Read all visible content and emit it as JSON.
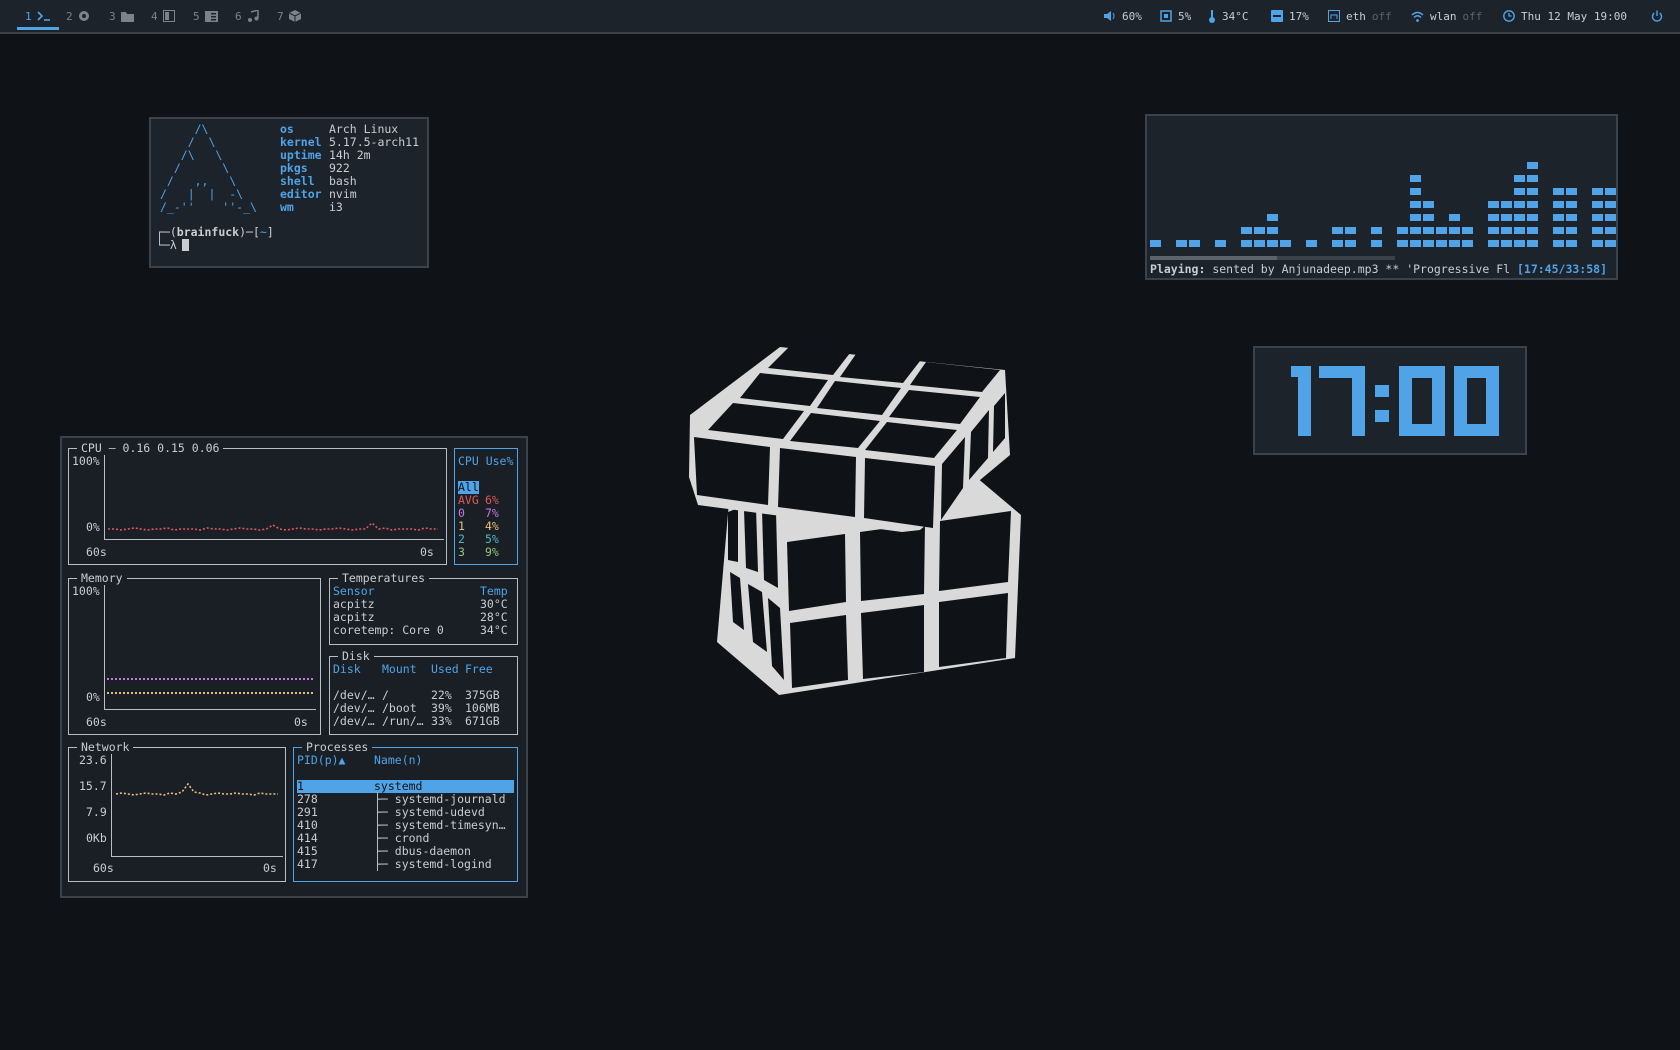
{
  "topbar": {
    "workspaces": [
      {
        "num": "1",
        "icon": "terminal-icon",
        "active": true
      },
      {
        "num": "2",
        "icon": "browser-icon",
        "active": false
      },
      {
        "num": "3",
        "icon": "folder-icon",
        "active": false
      },
      {
        "num": "4",
        "icon": "window-icon",
        "active": false
      },
      {
        "num": "5",
        "icon": "document-icon",
        "active": false
      },
      {
        "num": "6",
        "icon": "music-icon",
        "active": false
      },
      {
        "num": "7",
        "icon": "package-icon",
        "active": false
      }
    ],
    "status": {
      "volume": "60%",
      "cpu": "5%",
      "temp": "34°C",
      "memory": "17%",
      "eth_label": "eth",
      "eth_state": "off",
      "wlan_label": "wlan",
      "wlan_state": "off",
      "datetime": "Thu 12 May 19:00"
    }
  },
  "terminal": {
    "ascii_logo": "     /\\\n    /  \\\n   /\\   \\\n  /      \\\n /   ,,   \\\n/   |  |  -\\\n/_-''    ''-_\\",
    "info": [
      {
        "key": "os",
        "value": "Arch Linux"
      },
      {
        "key": "kernel",
        "value": "5.17.5-arch11"
      },
      {
        "key": "uptime",
        "value": "14h 2m"
      },
      {
        "key": "pkgs",
        "value": "922"
      },
      {
        "key": "shell",
        "value": "bash"
      },
      {
        "key": "editor",
        "value": "nvim"
      },
      {
        "key": "wm",
        "value": "i3"
      }
    ],
    "prompt_line1_prefix": "┌─(",
    "prompt_user": "brainfuck",
    "prompt_line1_mid": ")─[",
    "prompt_dir": "~",
    "prompt_line1_suffix": "]",
    "prompt_line2": "└─λ"
  },
  "music": {
    "playing_label": "Playing:",
    "track": "sented by Anjunadeep.mp3 ** 'Progressive Fl",
    "time": "[17:45/33:58]",
    "progress": 0.52,
    "bar_levels": [
      1,
      0,
      1,
      1,
      0,
      1,
      0,
      2,
      2,
      3,
      1,
      0,
      1,
      0,
      2,
      2,
      0,
      2,
      0,
      2,
      6,
      4,
      2,
      3,
      2,
      0,
      4,
      4,
      6,
      7,
      0,
      5,
      5,
      0,
      5,
      5
    ]
  },
  "clock": {
    "time": "17:00"
  },
  "monitor": {
    "cpu": {
      "title": "CPU — 0.16 0.15 0.06",
      "y_top": "100%",
      "y_bottom": "0%",
      "x_left": "60s",
      "x_right": "0s"
    },
    "cpu_use": {
      "title": "CPU Use%",
      "rows": [
        {
          "label": "All",
          "value": "",
          "color": "#4fa3e6"
        },
        {
          "label": "AVG",
          "value": "6%",
          "color": "#e05757"
        },
        {
          "label": "0",
          "value": "7%",
          "color": "#c678dd"
        },
        {
          "label": "1",
          "value": "4%",
          "color": "#e5c07b"
        },
        {
          "label": "2",
          "value": "5%",
          "color": "#56b6c2"
        },
        {
          "label": "3",
          "value": "9%",
          "color": "#98c379"
        }
      ]
    },
    "memory": {
      "title": "Memory",
      "y_top": "100%",
      "y_bottom": "0%",
      "x_left": "60s",
      "x_right": "0s"
    },
    "temperatures": {
      "title": "Temperatures",
      "col_sensor": "Sensor",
      "col_temp": "Temp",
      "rows": [
        {
          "sensor": "acpitz",
          "temp": "30°C"
        },
        {
          "sensor": "acpitz",
          "temp": "28°C"
        },
        {
          "sensor": "coretemp: Core 0",
          "temp": "34°C"
        }
      ]
    },
    "disk": {
      "title": "Disk",
      "cols": [
        "Disk",
        "Mount",
        "Used",
        "Free"
      ],
      "rows": [
        {
          "disk": "/dev/…",
          "mount": "/",
          "used": "22%",
          "free": "375GB"
        },
        {
          "disk": "/dev/…",
          "mount": "/boot",
          "used": "39%",
          "free": "106MB"
        },
        {
          "disk": "/dev/…",
          "mount": "/run/…",
          "used": "33%",
          "free": "671GB"
        }
      ]
    },
    "network": {
      "title": "Network",
      "y_ticks": [
        "23.6",
        "15.7",
        "7.9",
        "0Kb"
      ],
      "x_left": "60s",
      "x_right": "0s"
    },
    "processes": {
      "title": "Processes",
      "col_pid": "PID(p)▲",
      "col_name": "Name(n)",
      "rows": [
        {
          "pid": "1",
          "name": "systemd",
          "tree": ""
        },
        {
          "pid": "278",
          "name": "systemd-journald",
          "tree": "├─"
        },
        {
          "pid": "291",
          "name": "systemd-udevd",
          "tree": "├─"
        },
        {
          "pid": "410",
          "name": "systemd-timesyn…",
          "tree": "├─"
        },
        {
          "pid": "414",
          "name": "crond",
          "tree": "├─"
        },
        {
          "pid": "415",
          "name": "dbus-daemon",
          "tree": "├─"
        },
        {
          "pid": "417",
          "name": "systemd-logind",
          "tree": "├─"
        }
      ]
    }
  },
  "colors": {
    "accent": "#4fa3e6",
    "background": "#0f1318",
    "panel": "#1d232b",
    "cpu_line": "#e05757",
    "mem_line_1": "#c678dd",
    "mem_line_2": "#e5c07b",
    "net_line": "#e5c07b"
  }
}
